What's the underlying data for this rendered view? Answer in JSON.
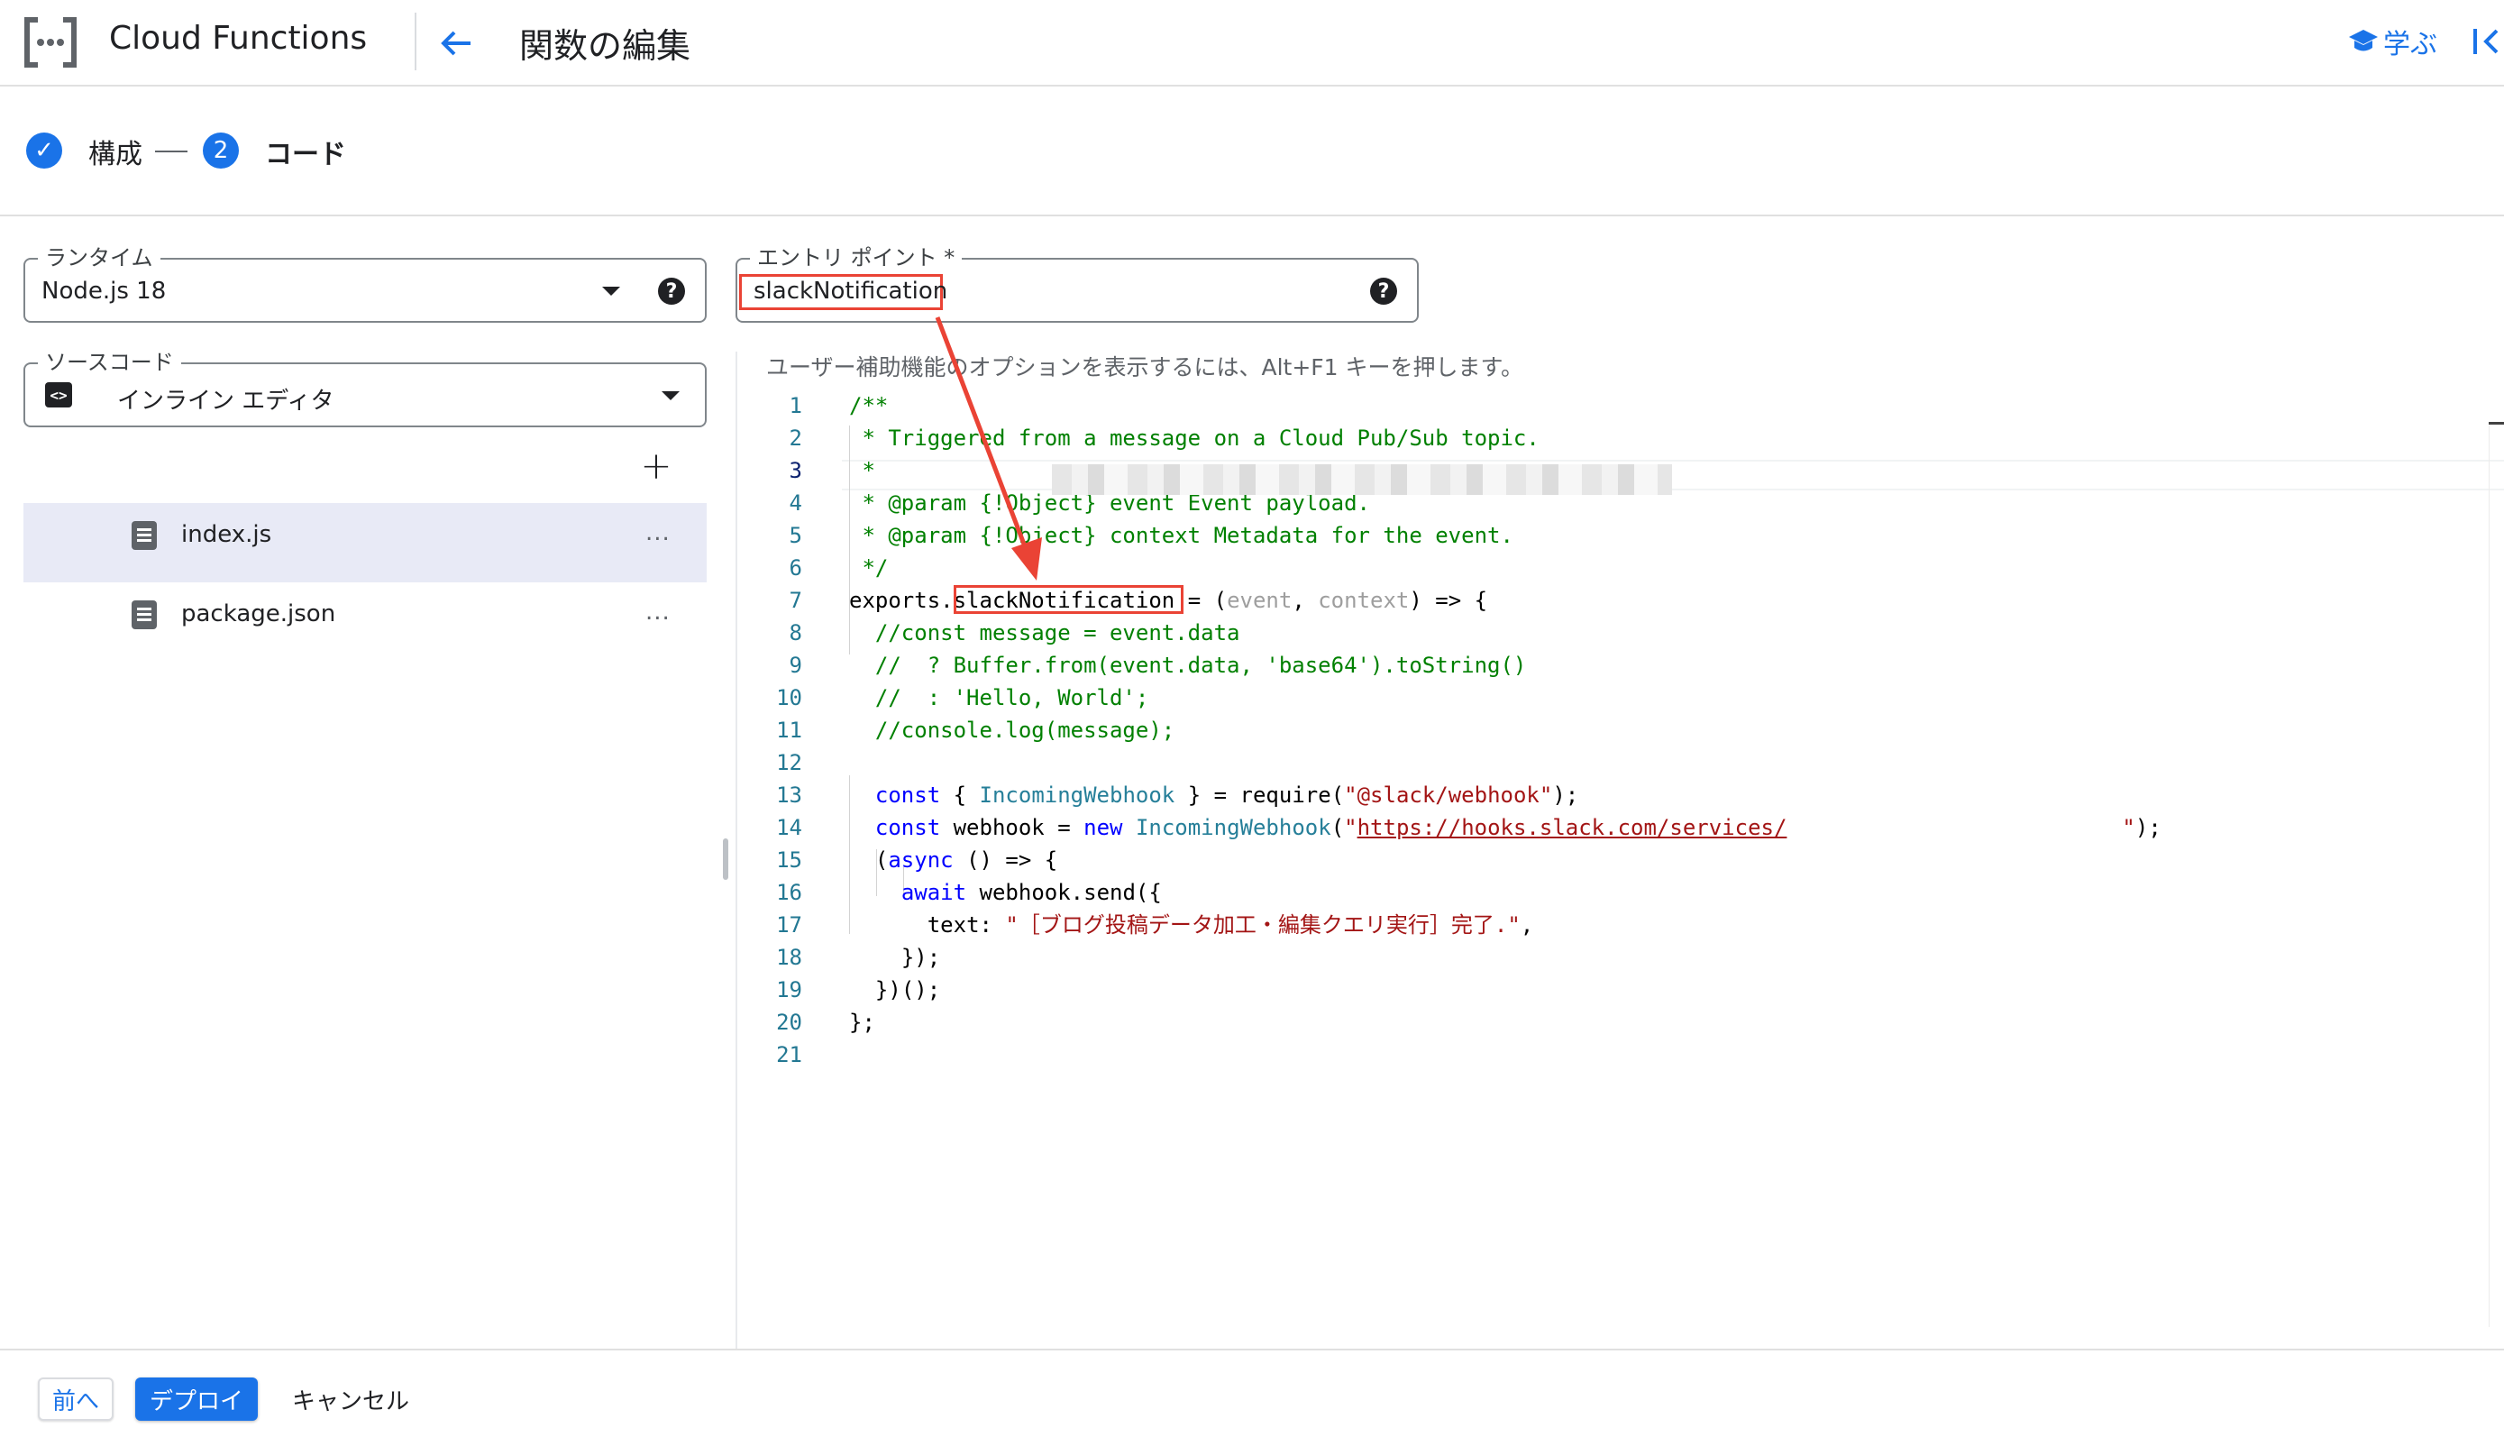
{
  "header": {
    "product_name": "Cloud Functions",
    "page_title": "関数の編集",
    "learn_label": "学ぶ",
    "icons": {
      "logo": "cloud-functions-logo",
      "back": "arrow-left-icon",
      "learn": "school-icon",
      "collapse": "collapse-panel-icon"
    }
  },
  "stepper": {
    "steps": [
      {
        "number": "✓",
        "label": "構成",
        "state": "completed"
      },
      {
        "number": "2",
        "label": "コード",
        "state": "active"
      }
    ]
  },
  "runtime": {
    "label": "ランタイム",
    "value": "Node.js 18"
  },
  "source_code": {
    "label": "ソースコード",
    "value": "インライン エディタ"
  },
  "entry_point": {
    "label": "エントリ ポイント *",
    "value": "slackNotification"
  },
  "files": [
    {
      "name": "index.js",
      "selected": true
    },
    {
      "name": "package.json",
      "selected": false
    }
  ],
  "file_menu_glyph": "...",
  "add_file_glyph": "+",
  "editor": {
    "hint": "ユーザー補助機能のオプションを表示するには、Alt+F1 キーを押します。",
    "current_line": 3,
    "lines": [
      "/**",
      " * Triggered from a message on a Cloud Pub/Sub topic.",
      " *",
      " * @param {!Object} event Event payload.",
      " * @param {!Object} context Metadata for the event.",
      " */",
      "exports.slackNotification = (event, context) => {",
      "  //const message = event.data",
      "  //  ? Buffer.from(event.data, 'base64').toString()",
      "  //  : 'Hello, World';",
      "  //console.log(message);",
      "",
      "  const { IncomingWebhook } = require(\"@slack/webhook\");",
      "  const webhook = new IncomingWebhook(\"https://hooks.slack.com/services/\");",
      "  (async () => {",
      "    await webhook.send({",
      "      text: \"［ブログ投稿データ加工・編集クエリ実行］完了.\",",
      "    });",
      "  })();",
      "};",
      ""
    ]
  },
  "footer": {
    "prev_label": "前へ",
    "deploy_label": "デプロイ",
    "cancel_label": "キャンセル"
  },
  "colors": {
    "accent": "#1a73e8",
    "annotation": "#ea4335"
  }
}
